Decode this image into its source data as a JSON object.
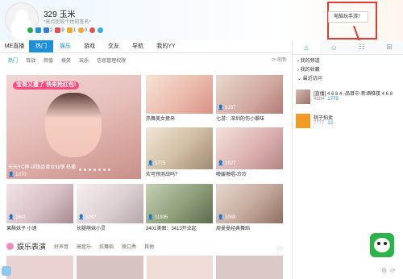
{
  "profile": {
    "name": "329 玉米",
    "signature": "*来点比较个性的签名*",
    "badges": [
      {
        "icon": "shield-icon",
        "color": "#2aa64b",
        "text": ""
      },
      {
        "icon": "v-icon",
        "color": "#1e90d8",
        "text": ""
      },
      {
        "icon": "user-icon",
        "color": "#3a7bd5",
        "text": "2"
      },
      {
        "icon": "vip-icon",
        "color": "#e84d4d",
        "text": "9"
      },
      {
        "icon": "yellow-icon",
        "color": "#f5a623",
        "text": "1"
      },
      {
        "icon": "gold-icon",
        "color": "#f5a623",
        "text": "0"
      },
      {
        "icon": "heart-icon",
        "color": "#e84d4d",
        "text": ""
      },
      {
        "icon": "eye-icon",
        "color": "#3ab0e2",
        "text": ""
      }
    ]
  },
  "tooltip": "电脑玩手游！",
  "mainnav": [
    "ME直播",
    "热门",
    "娱乐",
    "游戏",
    "交友",
    "导航",
    "我的YY"
  ],
  "subnav": [
    "热门",
    "百战",
    "颜值",
    "搞笑",
    "玩乐",
    "信息管理权限"
  ],
  "refresh": "刷新",
  "feature": {
    "pill": "宝哥又瘦了 快来抢红包!",
    "label": "天天YC神-ぽ极品美女仙钢 热播",
    "viewers": "1070"
  },
  "tiles": [
    {
      "caption": "热舞美女撩来",
      "viewers": ""
    },
    {
      "caption": "七游：深圳的伤小暴味",
      "viewers": "5167"
    },
    {
      "caption": "欢可预测战吗？",
      "viewers": "1775"
    },
    {
      "caption": "嗷媛嗷唱-玲玲",
      "viewers": "1027"
    },
    {
      "caption": "果酥妹子 小速",
      "viewers": "1641"
    },
    {
      "caption": "长腿萌妹小灵",
      "viewers": "1097"
    },
    {
      "caption": "3401美图：3413开业起",
      "viewers": "11935"
    },
    {
      "caption": "周曼曼经典舞蹈",
      "viewers": "1068"
    }
  ],
  "section": {
    "title": "娱乐表演",
    "links": [
      "好声音",
      "高音乐",
      "炫舞蹈",
      "脱口秀",
      "其他"
    ]
  },
  "sidebar": {
    "groups": [
      "我的频道",
      "我的收藏",
      "最近访问"
    ],
    "entries": [
      {
        "name": "[直播] 4 6 8 4 -品目中-新酒唯楼 4 6 8",
        "count1": "4684",
        "count2": "1779"
      },
      {
        "name": "桃子拍卖",
        "count1": "7777",
        "count2": "12"
      }
    ]
  }
}
